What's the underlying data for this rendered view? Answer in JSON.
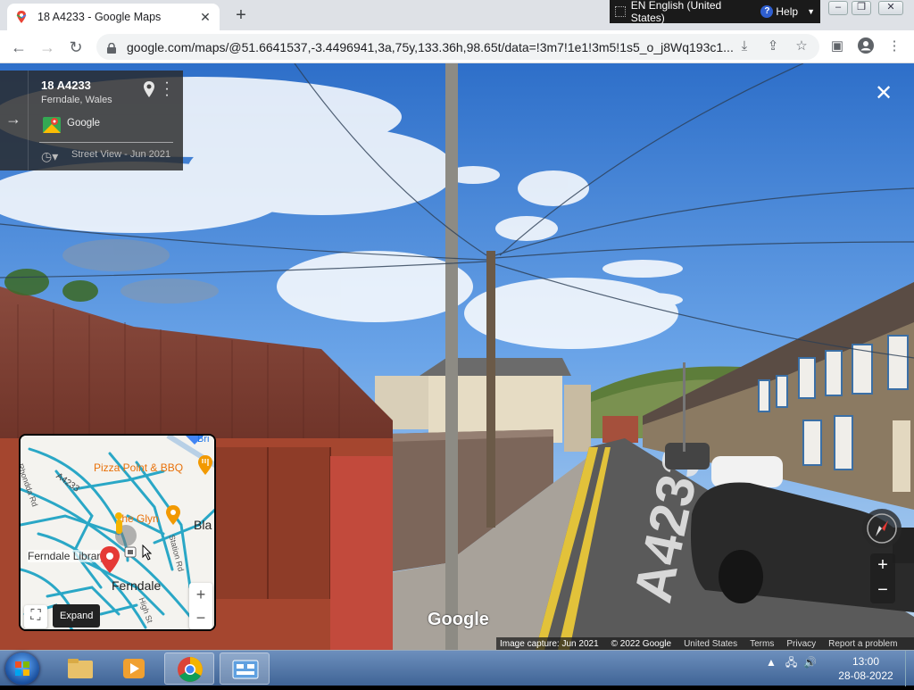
{
  "browser": {
    "tab_title": "18 A4233 - Google Maps",
    "url": "google.com/maps/@51.6641537,-3.4496941,3a,75y,133.36h,98.65t/data=!3m7!1e1!3m5!1s5_o_j8Wq193c1...",
    "icons": [
      "back-icon",
      "forward-icon",
      "reload-icon",
      "lock-icon",
      "install-icon",
      "share-icon",
      "star-icon",
      "sidepanel-icon",
      "profile-icon",
      "menu-icon"
    ]
  },
  "language_bar": {
    "language": "EN English (United States)",
    "help": "Help"
  },
  "infocard": {
    "address": "18 A4233",
    "locality": "Ferndale, Wales",
    "contributor": "Google",
    "street_view_date": "Street View - Jun 2021"
  },
  "road_marking": "A4233",
  "minimap": {
    "labels": {
      "pizza": "Pizza Point & BBQ",
      "glyn": "The Glyn",
      "bla": "Bla",
      "library": "Ferndale Library",
      "ferndale": "Ferndale",
      "a4233": "A4233",
      "rhondda": "Rhondda Rd",
      "station": "Station Rd",
      "high": "High St",
      "bri": "Bri"
    },
    "zoom_in": "+",
    "zoom_out": "−",
    "expand_tooltip": "Expand"
  },
  "controls": {
    "zoom_in": "+",
    "zoom_out": "−"
  },
  "google_logo": "Google",
  "footer": {
    "capture": "Image capture: Jun 2021",
    "copyright": "© 2022 Google",
    "country": "United States",
    "terms": "Terms",
    "privacy": "Privacy",
    "report": "Report a problem"
  },
  "taskbar": {
    "time": "13:00",
    "date": "28-08-2022"
  },
  "colors": {
    "sky": "#4a8fe0",
    "road": "#5a5a5a",
    "map_road": "#2aa7c6",
    "accent_red": "#e53935"
  }
}
